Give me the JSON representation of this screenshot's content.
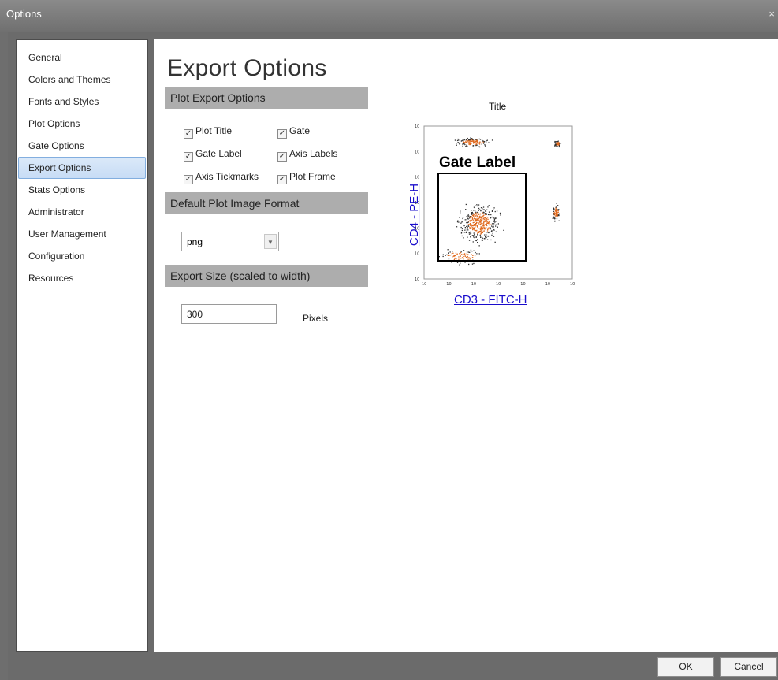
{
  "window": {
    "title": "Options",
    "close_glyph": "×"
  },
  "sidebar": {
    "items": [
      {
        "label": "General"
      },
      {
        "label": "Colors and Themes"
      },
      {
        "label": "Fonts and Styles"
      },
      {
        "label": "Plot Options"
      },
      {
        "label": "Gate Options"
      },
      {
        "label": "Export Options",
        "active": true
      },
      {
        "label": "Stats Options"
      },
      {
        "label": "Administrator"
      },
      {
        "label": "User Management"
      },
      {
        "label": "Configuration"
      },
      {
        "label": "Resources"
      }
    ]
  },
  "main": {
    "title": "Export Options",
    "plot_export": {
      "header": "Plot Export Options",
      "options": [
        {
          "label": "Plot Title",
          "checked": true
        },
        {
          "label": "Gate",
          "checked": true
        },
        {
          "label": "Gate Label",
          "checked": true
        },
        {
          "label": "Axis Labels",
          "checked": true
        },
        {
          "label": "Axis Tickmarks",
          "checked": true
        },
        {
          "label": "Plot Frame",
          "checked": true
        }
      ]
    },
    "image_format": {
      "header": "Default Plot Image Format",
      "value": "png"
    },
    "export_size": {
      "header": "Export Size (scaled to width)",
      "value": "300",
      "unit_label": "Pixels"
    },
    "preview": {
      "title": "Title",
      "gate_label": "Gate Label",
      "x_axis_label": "CD3 - FITC-H",
      "y_axis_label": "CD4 - PE-H",
      "tick_label": "10",
      "colors": {
        "dots": "#333333",
        "density_high": "#e06a1e",
        "axis_link": "#1a0dcc"
      }
    }
  },
  "footer": {
    "ok_label": "OK",
    "cancel_label": "Cancel"
  }
}
